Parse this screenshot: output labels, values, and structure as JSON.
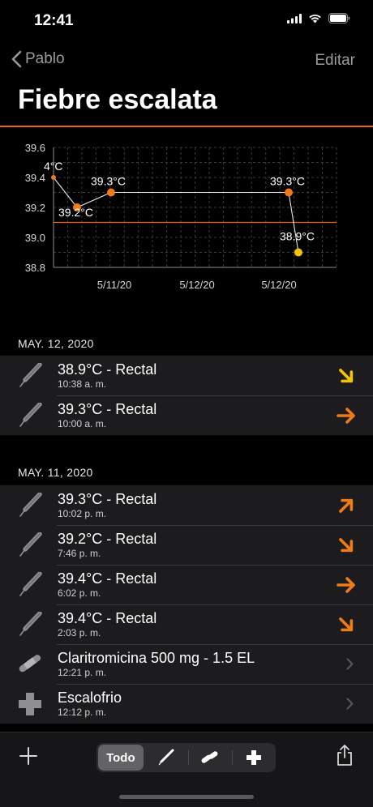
{
  "status": {
    "time": "12:41"
  },
  "nav": {
    "back_label": "Pablo",
    "edit_label": "Editar"
  },
  "page": {
    "title": "Fiebre escalata"
  },
  "colors": {
    "accent": "#e8651a",
    "trend_orange": "#f07a16",
    "trend_yellow": "#f5c400",
    "background": "#000000"
  },
  "chart_data": {
    "type": "line",
    "y_ticks": [
      "39.6",
      "39.4",
      "39.2",
      "39.0",
      "38.8"
    ],
    "ylim": [
      38.8,
      39.6
    ],
    "x_ticks": [
      "5/11/20",
      "5/12/20",
      "5/12/20"
    ],
    "reference_line": 39.1,
    "points": [
      {
        "label": "4°C",
        "value": 39.4,
        "color": "orange"
      },
      {
        "label": "39.2°C",
        "value": 39.2,
        "color": "orange"
      },
      {
        "label": "39.3°C",
        "value": 39.3,
        "color": "orange"
      },
      {
        "label": "39.3°C",
        "value": 39.3,
        "color": "orange"
      },
      {
        "label": "38.9°C",
        "value": 38.9,
        "color": "yellow"
      }
    ],
    "grid": true
  },
  "sections": [
    {
      "date": "MAY. 12, 2020",
      "items": [
        {
          "title": "38.9°C - Rectal",
          "time": "10:38 a. m.",
          "icon": "thermometer-icon",
          "trend": "down-right",
          "trend_color": "yellow"
        },
        {
          "title": "39.3°C - Rectal",
          "time": "10:00 a. m.",
          "icon": "thermometer-icon",
          "trend": "right",
          "trend_color": "orange"
        }
      ]
    },
    {
      "date": "MAY. 11, 2020",
      "items": [
        {
          "title": "39.3°C - Rectal",
          "time": "10:02 p. m.",
          "icon": "thermometer-icon",
          "trend": "up-right",
          "trend_color": "orange"
        },
        {
          "title": "39.2°C - Rectal",
          "time": "7:46 p. m.",
          "icon": "thermometer-icon",
          "trend": "down-right",
          "trend_color": "orange"
        },
        {
          "title": "39.4°C - Rectal",
          "time": "6:02 p. m.",
          "icon": "thermometer-icon",
          "trend": "right",
          "trend_color": "orange"
        },
        {
          "title": "39.4°C - Rectal",
          "time": "2:03 p. m.",
          "icon": "thermometer-icon",
          "trend": "down-right",
          "trend_color": "orange"
        },
        {
          "title": "Claritromicina 500 mg - 1.5 EL",
          "time": "12:21 p. m.",
          "icon": "pills-icon",
          "trend": "chevron"
        },
        {
          "title": "Escalofrio",
          "time": "12:12 p. m.",
          "icon": "cross-icon",
          "trend": "chevron"
        }
      ]
    }
  ],
  "tabbar": {
    "segments": [
      {
        "label": "Todo",
        "icon": "",
        "active": true
      },
      {
        "label": "",
        "icon": "thermometer-icon",
        "active": false
      },
      {
        "label": "",
        "icon": "pills-icon",
        "active": false
      },
      {
        "label": "",
        "icon": "cross-icon",
        "active": false
      }
    ]
  }
}
